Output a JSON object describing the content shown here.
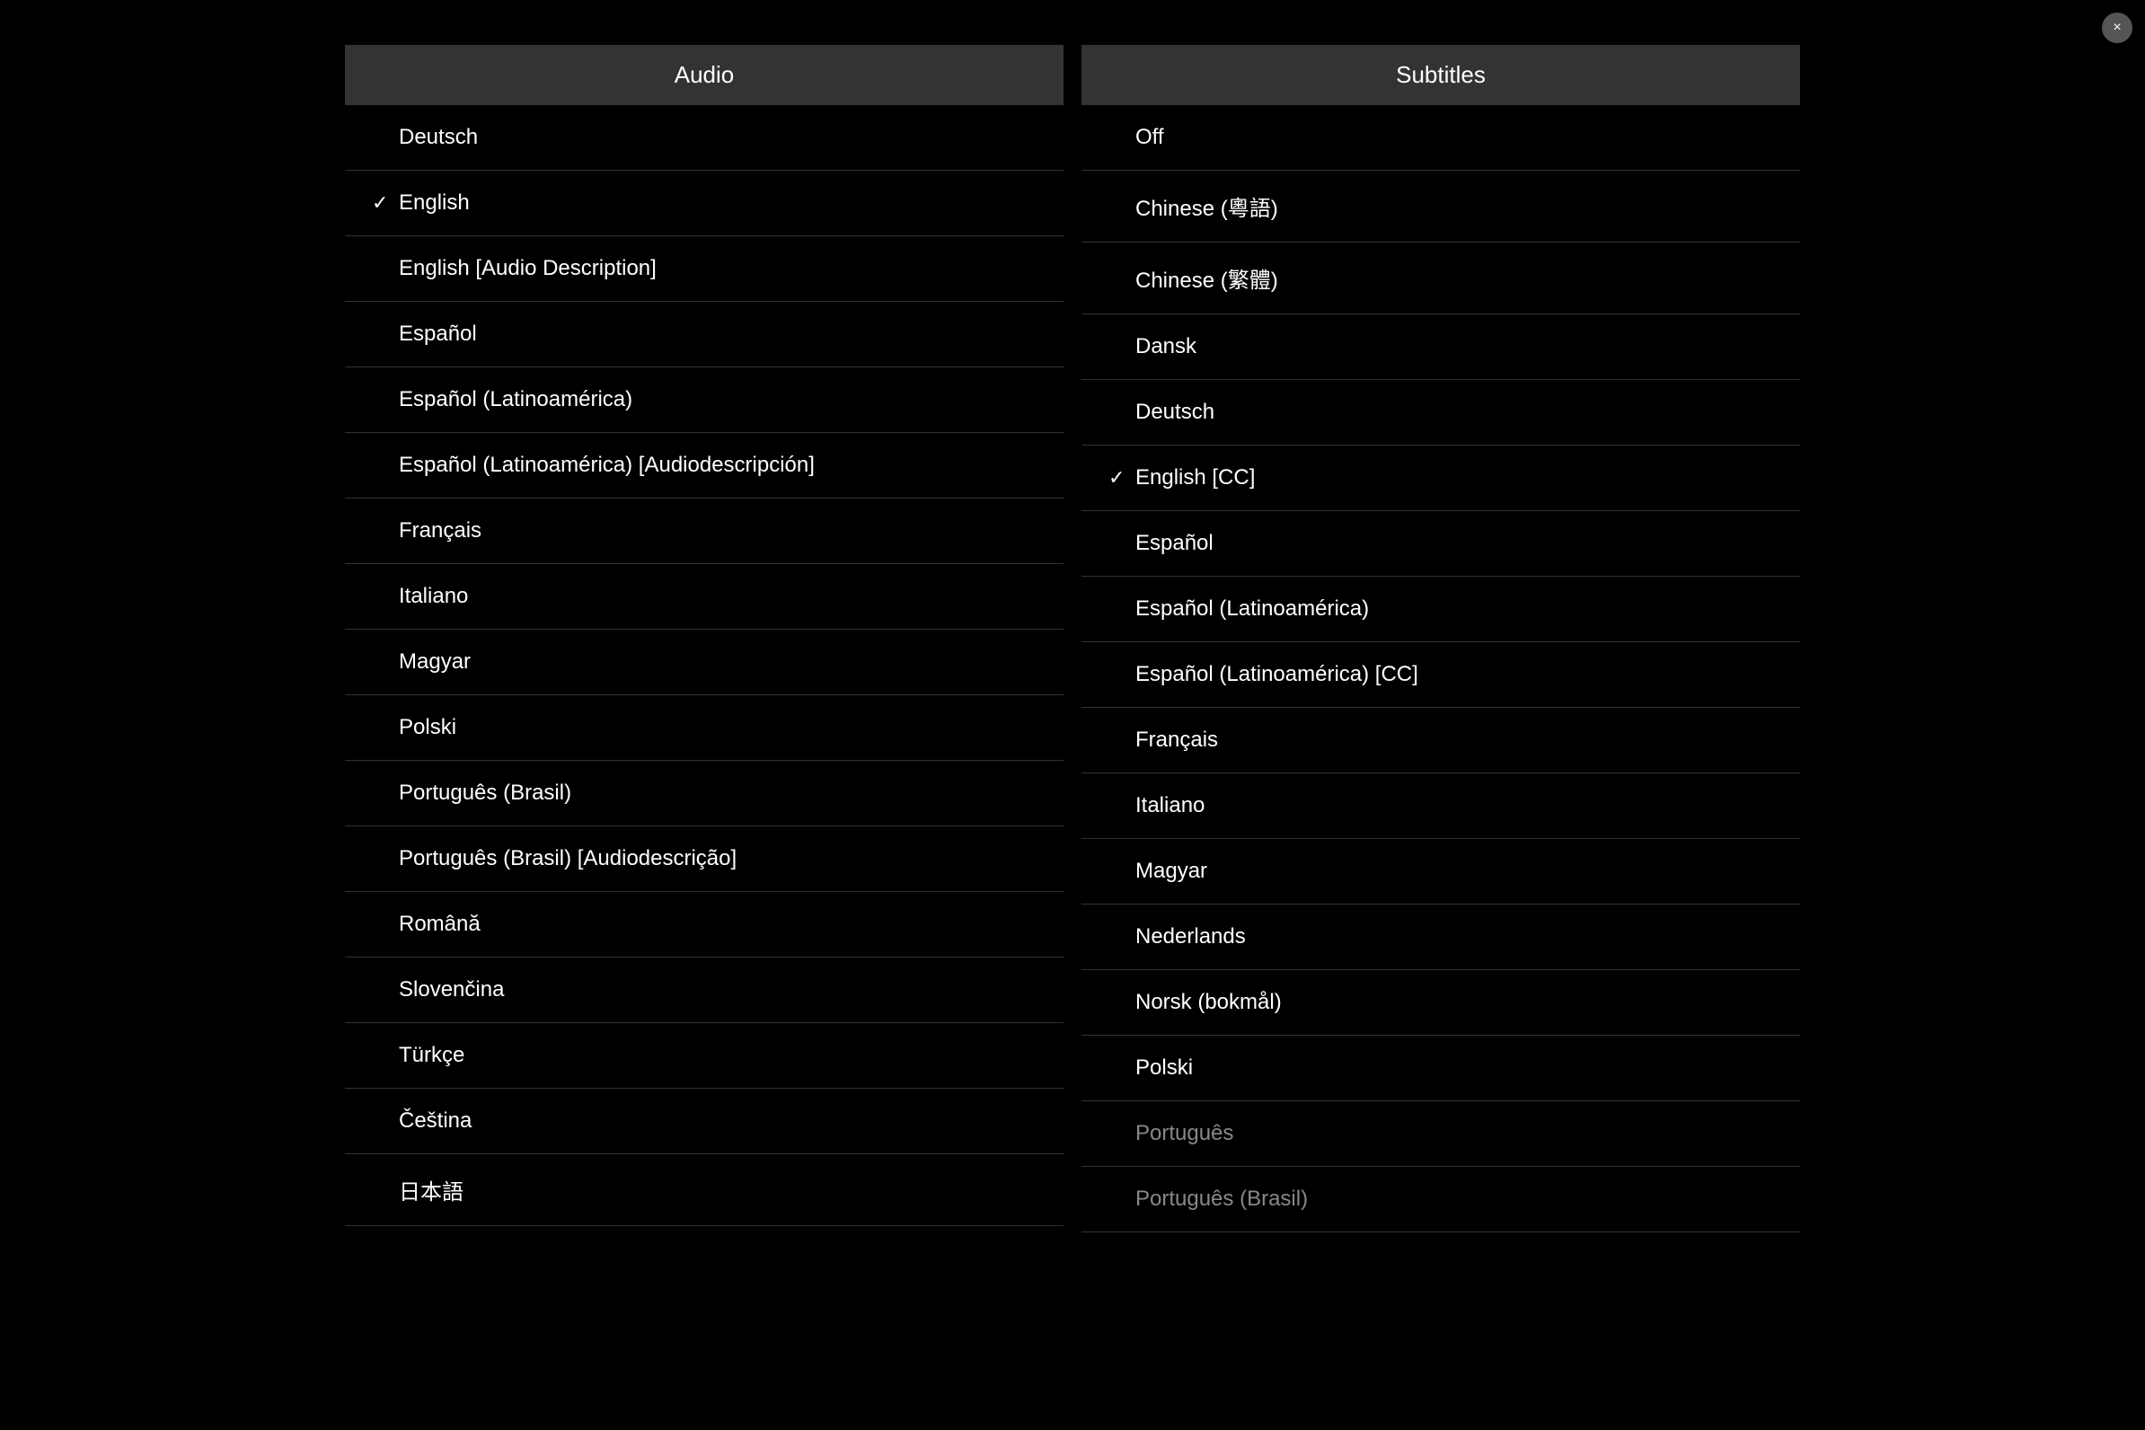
{
  "close_button_label": "×",
  "audio": {
    "header": "Audio",
    "items": [
      {
        "label": "Deutsch",
        "selected": false
      },
      {
        "label": "English",
        "selected": true
      },
      {
        "label": "English [Audio Description]",
        "selected": false
      },
      {
        "label": "Español",
        "selected": false
      },
      {
        "label": "Español (Latinoamérica)",
        "selected": false
      },
      {
        "label": "Español (Latinoamérica) [Audiodescripción]",
        "selected": false
      },
      {
        "label": "Français",
        "selected": false
      },
      {
        "label": "Italiano",
        "selected": false
      },
      {
        "label": "Magyar",
        "selected": false
      },
      {
        "label": "Polski",
        "selected": false
      },
      {
        "label": "Português (Brasil)",
        "selected": false
      },
      {
        "label": "Português (Brasil) [Audiodescrição]",
        "selected": false
      },
      {
        "label": "Română",
        "selected": false
      },
      {
        "label": "Slovenčina",
        "selected": false
      },
      {
        "label": "Türkçe",
        "selected": false
      },
      {
        "label": "Čeština",
        "selected": false
      },
      {
        "label": "日本語",
        "selected": false
      }
    ]
  },
  "subtitles": {
    "header": "Subtitles",
    "items": [
      {
        "label": "Off",
        "selected": false
      },
      {
        "label": "Chinese (粵語)",
        "selected": false
      },
      {
        "label": "Chinese (繁體)",
        "selected": false
      },
      {
        "label": "Dansk",
        "selected": false
      },
      {
        "label": "Deutsch",
        "selected": false
      },
      {
        "label": "English [CC]",
        "selected": true
      },
      {
        "label": "Español",
        "selected": false
      },
      {
        "label": "Español (Latinoamérica)",
        "selected": false
      },
      {
        "label": "Español (Latinoamérica) [CC]",
        "selected": false
      },
      {
        "label": "Français",
        "selected": false
      },
      {
        "label": "Italiano",
        "selected": false
      },
      {
        "label": "Magyar",
        "selected": false
      },
      {
        "label": "Nederlands",
        "selected": false
      },
      {
        "label": "Norsk (bokmål)",
        "selected": false
      },
      {
        "label": "Polski",
        "selected": false
      },
      {
        "label": "Português",
        "selected": false,
        "dimmed": true
      },
      {
        "label": "Português (Brasil)",
        "selected": false,
        "dimmed": true
      }
    ]
  }
}
